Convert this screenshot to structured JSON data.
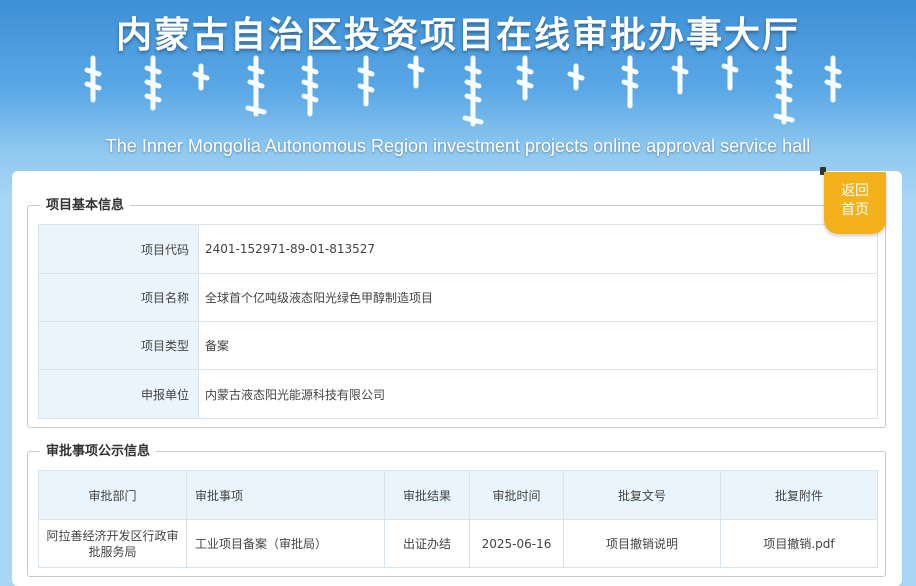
{
  "banner": {
    "title": "内蒙古自治区投资项目在线审批办事大厅",
    "subtitle_en": "The Inner Mongolia Autonomous Region investment projects online approval service hall"
  },
  "back_button": {
    "line1": "返回",
    "line2": "首页"
  },
  "basic_info": {
    "legend": "项目基本信息",
    "rows": [
      {
        "label": "项目代码",
        "value": "2401-152971-89-01-813527"
      },
      {
        "label": "项目名称",
        "value": "全球首个亿吨级液态阳光绿色甲醇制造项目"
      },
      {
        "label": "项目类型",
        "value": "备案"
      },
      {
        "label": "申报单位",
        "value": "内蒙古液态阳光能源科技有限公司"
      }
    ]
  },
  "approval_info": {
    "legend": "审批事项公示信息",
    "headers": [
      "审批部门",
      "审批事项",
      "审批结果",
      "审批时间",
      "批复文号",
      "批复附件"
    ],
    "rows": [
      {
        "dept": "阿拉善经济开发区行政审批服务局",
        "item": "工业项目备案（审批局）",
        "result": "出证办结",
        "time": "2025-06-16",
        "doc_no": "项目撤销说明",
        "attachment": "项目撤销.pdf"
      }
    ]
  },
  "colors": {
    "banner_top": "#3d8fd6",
    "label_bg": "#e9f4fc",
    "back_button": "#f3b21b"
  }
}
